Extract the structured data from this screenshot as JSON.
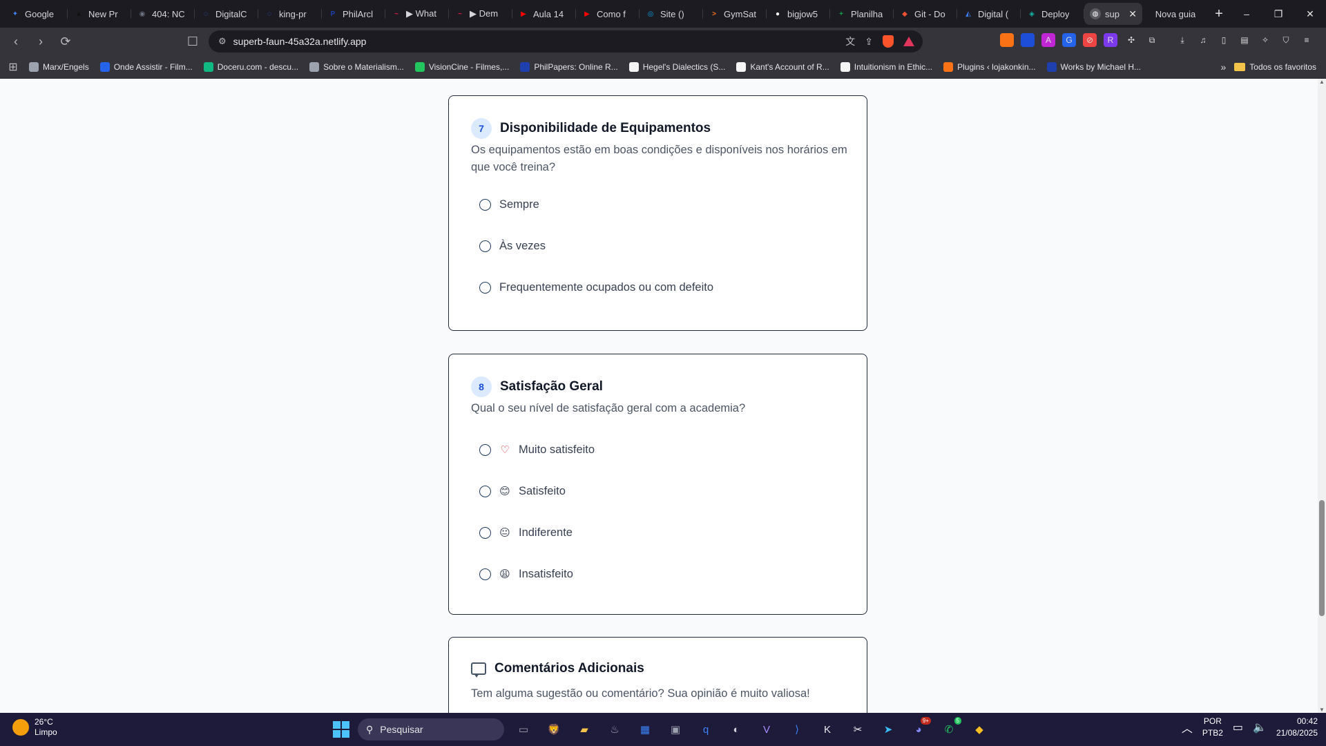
{
  "browser": {
    "tabs": [
      {
        "title": "Google",
        "color": "#4285f4",
        "glyph": "✦"
      },
      {
        "title": "New Pr",
        "color": "#111111",
        "glyph": "▲"
      },
      {
        "title": "404: NC",
        "color": "#6b7280",
        "glyph": "◉"
      },
      {
        "title": "DigitalC",
        "color": "#2563eb",
        "glyph": "◌"
      },
      {
        "title": "king-pr",
        "color": "#2563eb",
        "glyph": "◌"
      },
      {
        "title": "PhilArcl",
        "color": "#1e40af",
        "glyph": "P"
      },
      {
        "title": "▶ What",
        "color": "#e11d48",
        "glyph": "~"
      },
      {
        "title": "▶ Dem",
        "color": "#e11d48",
        "glyph": "~"
      },
      {
        "title": "Aula 14",
        "color": "#ff0000",
        "glyph": "▶"
      },
      {
        "title": "Como f",
        "color": "#ff0000",
        "glyph": "▶"
      },
      {
        "title": "Site ()",
        "color": "#0ea5e9",
        "glyph": "◎"
      },
      {
        "title": "GymSat",
        "color": "#f97316",
        "glyph": ">"
      },
      {
        "title": "bigjow5",
        "color": "#ffffff",
        "glyph": "●"
      },
      {
        "title": "Planilha",
        "color": "#16a34a",
        "glyph": "+"
      },
      {
        "title": "Git - Do",
        "color": "#f05033",
        "glyph": "◆"
      },
      {
        "title": "Digital (",
        "color": "#3b82f6",
        "glyph": "◭"
      },
      {
        "title": "Deploy",
        "color": "#14b8a6",
        "glyph": "◈"
      }
    ],
    "active_tab": {
      "title": "sup",
      "close": "✕"
    },
    "new_tab": "Nova guia",
    "new_tab_plus": "+",
    "window_controls": {
      "minimize": "–",
      "maximize": "❐",
      "close": "✕"
    },
    "url": "superb-faun-45a32a.netlify.app",
    "bookmarks": [
      {
        "title": "Marx/Engels",
        "color": "#9ca3af"
      },
      {
        "title": "Onde Assistir - Film...",
        "color": "#2563eb"
      },
      {
        "title": "Doceru.com - descu...",
        "color": "#10b981"
      },
      {
        "title": "Sobre o Materialism...",
        "color": "#9ca3af"
      },
      {
        "title": "VisionCine - Filmes,...",
        "color": "#22c55e"
      },
      {
        "title": "PhilPapers: Online R...",
        "color": "#1e40af"
      },
      {
        "title": "Hegel's Dialectics (S...",
        "color": "#f5f5f5"
      },
      {
        "title": "Kant's Account of R...",
        "color": "#f5f5f5"
      },
      {
        "title": "Intuitionism in Ethic...",
        "color": "#f5f5f5"
      },
      {
        "title": "Plugins ‹ lojakonkin...",
        "color": "#f97316"
      },
      {
        "title": "Works by Michael H...",
        "color": "#1e40af"
      }
    ],
    "bookmarks_more": "»",
    "bookmarks_folder": "Todos os favoritos"
  },
  "survey": {
    "q7": {
      "number": "7",
      "title": "Disponibilidade de Equipamentos",
      "description": "Os equipamentos estão em boas condições e disponíveis nos horários em que você treina?",
      "options": [
        "Sempre",
        "Às vezes",
        "Frequentemente ocupados ou com defeito"
      ]
    },
    "q8": {
      "number": "8",
      "title": "Satisfação Geral",
      "description": "Qual o seu nível de satisfação geral com a academia?",
      "options": [
        {
          "emoji": "♡",
          "label": "Muito satisfeito"
        },
        {
          "emoji": "😊",
          "label": "Satisfeito"
        },
        {
          "emoji": "😐",
          "label": "Indiferente"
        },
        {
          "emoji": "😩",
          "label": "Insatisfeito"
        }
      ]
    },
    "comments": {
      "title": "Comentários Adicionais",
      "description": "Tem alguma sugestão ou comentário? Sua opinião é muito valiosa!"
    }
  },
  "taskbar": {
    "weather": {
      "temp": "26°C",
      "condition": "Limpo"
    },
    "search_placeholder": "Pesquisar",
    "apps": [
      {
        "name": "task-view",
        "glyph": "▭",
        "color": "#9ca3af"
      },
      {
        "name": "brave",
        "glyph": "🦁",
        "color": "#fb542b"
      },
      {
        "name": "file-explorer",
        "glyph": "▰",
        "color": "#f4c34a"
      },
      {
        "name": "steam",
        "glyph": "♨",
        "color": "#9ca3af"
      },
      {
        "name": "ms-store",
        "glyph": "▦",
        "color": "#3b82f6"
      },
      {
        "name": "app-6",
        "glyph": "▣",
        "color": "#9ca3af"
      },
      {
        "name": "qbittorrent",
        "glyph": "q",
        "color": "#3b82f6"
      },
      {
        "name": "obs",
        "glyph": "◐",
        "color": "#d1d5db"
      },
      {
        "name": "visual-studio",
        "glyph": "V",
        "color": "#a78bfa"
      },
      {
        "name": "vscode",
        "glyph": "⟩",
        "color": "#3b82f6"
      },
      {
        "name": "app-k",
        "glyph": "K",
        "color": "#e5e7eb"
      },
      {
        "name": "capcut",
        "glyph": "✂",
        "color": "#f5f5f5"
      },
      {
        "name": "telegram",
        "glyph": "➤",
        "color": "#38bdf8"
      },
      {
        "name": "discord",
        "glyph": "◕",
        "color": "#818cf8",
        "badge": "9+"
      },
      {
        "name": "whatsapp",
        "glyph": "✆",
        "color": "#22c55e",
        "badge": "5"
      },
      {
        "name": "git-tool",
        "glyph": "◆",
        "color": "#fbbf24"
      }
    ],
    "tray_chevron": "︿",
    "lang": {
      "line1": "POR",
      "line2": "PTB2"
    },
    "clock": {
      "time": "00:42",
      "date": "21/08/2025"
    }
  }
}
